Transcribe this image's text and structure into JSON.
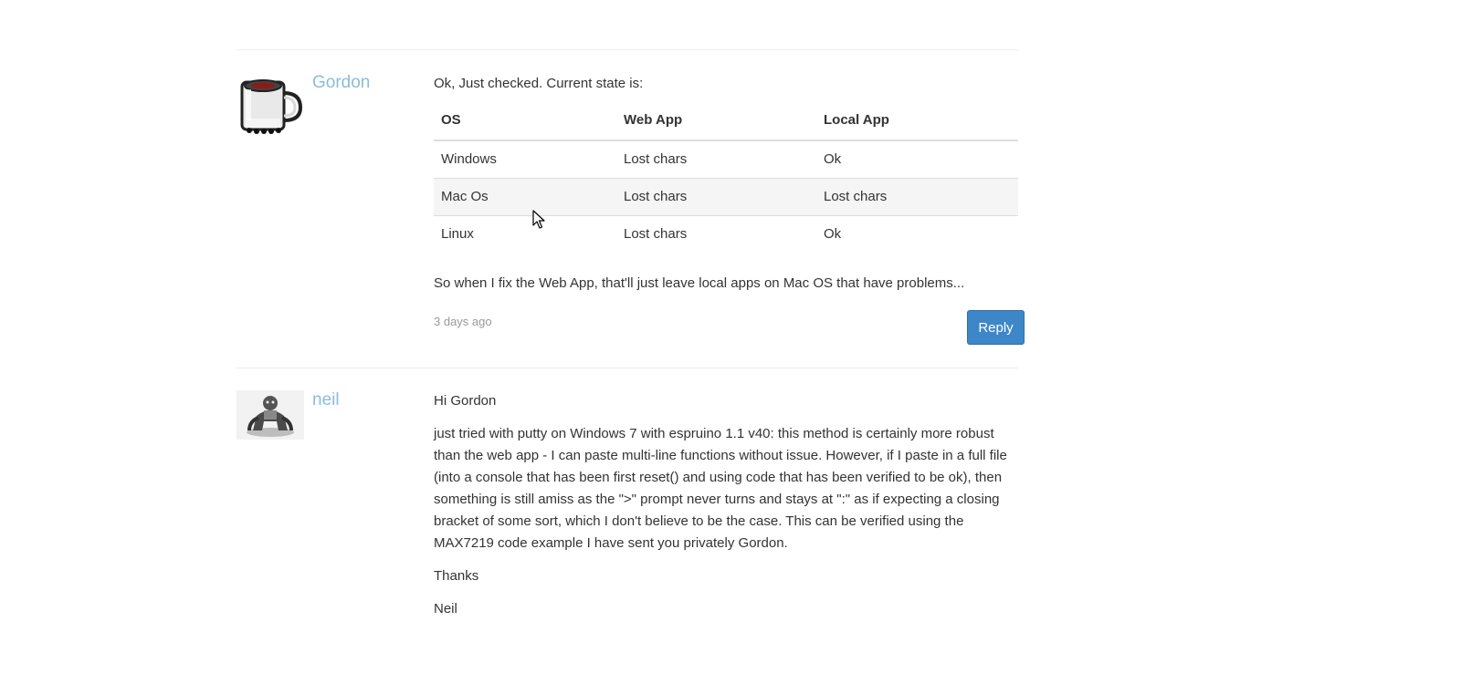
{
  "posts": [
    {
      "author": "Gordon",
      "avatar_icon": "coffee-mug-icon",
      "intro": "Ok, Just checked. Current state is:",
      "table": {
        "headers": [
          "OS",
          "Web App",
          "Local App"
        ],
        "rows": [
          [
            "Windows",
            "Lost chars",
            "Ok"
          ],
          [
            "Mac Os",
            "Lost chars",
            "Lost chars"
          ],
          [
            "Linux",
            "Lost chars",
            "Ok"
          ]
        ]
      },
      "outro": "So when I fix the Web App, that'll just leave local apps on Mac OS that have problems...",
      "timestamp": "3 days ago",
      "reply_label": "Reply"
    },
    {
      "author": "neil",
      "avatar_icon": "ape-figure-icon",
      "paragraphs": [
        "Hi Gordon",
        "just tried with putty on Windows 7 with espruino 1.1 v40: this method is certainly more robust than the web app - I can paste multi-line functions without issue. However, if I paste in a full file (into a console that has been first reset() and using code that has been verified to be ok), then something is still amiss as the \">\" prompt never turns and stays at \":\" as if expecting a closing bracket of some sort, which I don't believe to be the case. This can be verified using the MAX7219 code example I have sent you privately Gordon.",
        "Thanks",
        "Neil"
      ]
    }
  ],
  "colors": {
    "author_link": "#8bbdd8",
    "reply_button": "#3d87c8",
    "text": "#333333",
    "timestamp": "#999999"
  }
}
